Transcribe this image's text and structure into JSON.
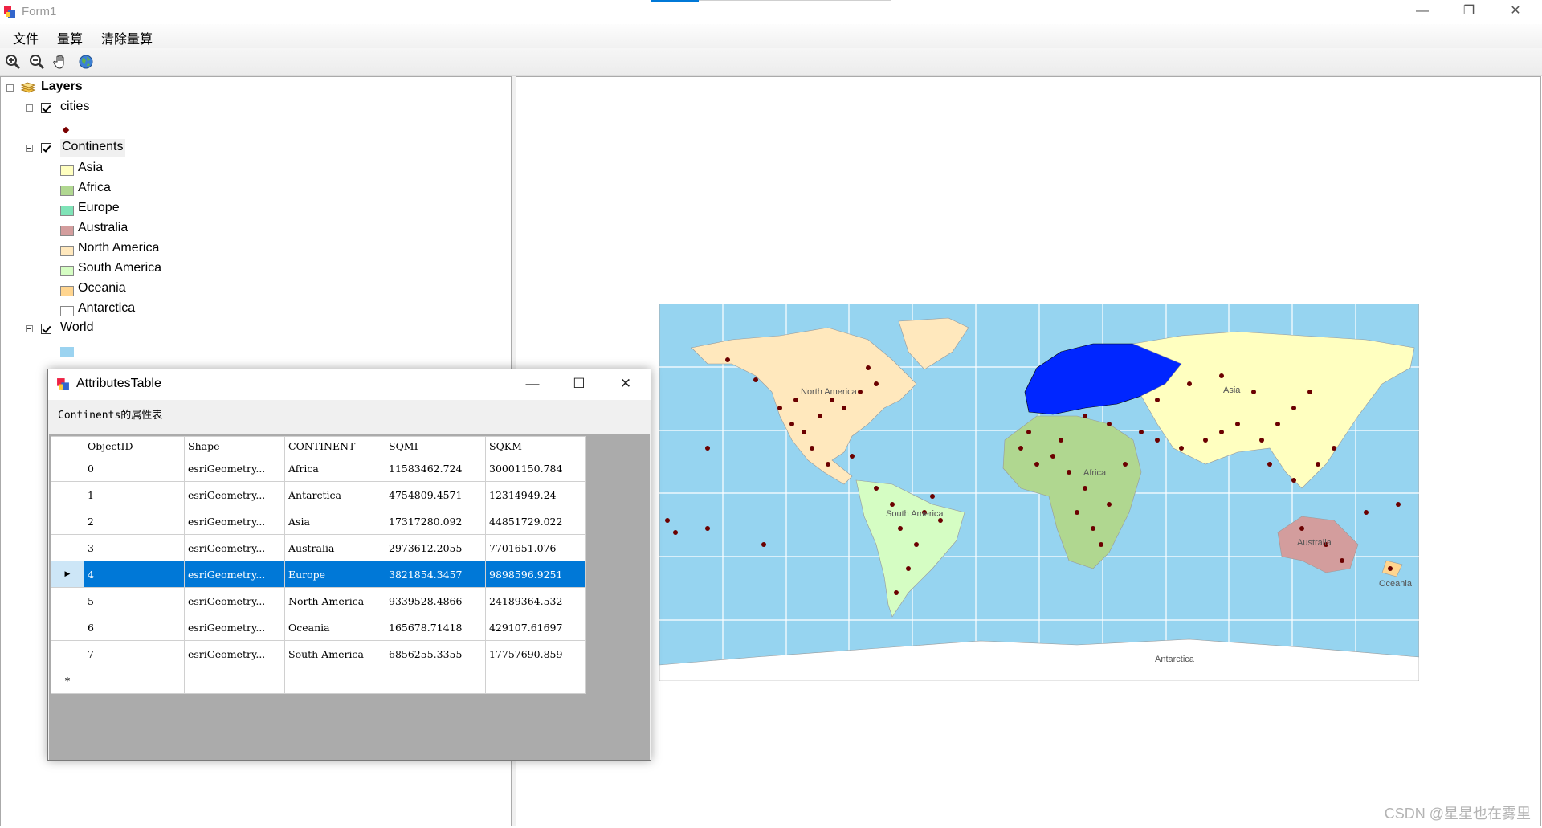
{
  "window": {
    "title": "Form1",
    "controls": {
      "minimize": "—",
      "restore": "❐",
      "close": "✕"
    }
  },
  "menu": {
    "items": [
      "文件",
      "量算",
      "清除量算"
    ]
  },
  "toolbar": {
    "tools": [
      "zoom-in-icon",
      "zoom-out-icon",
      "pan-hand-icon",
      "full-extent-globe-icon"
    ]
  },
  "toc": {
    "root": "Layers",
    "layers": [
      {
        "name": "cities",
        "checked": true
      },
      {
        "name": "Continents",
        "checked": true
      },
      {
        "name": "World",
        "checked": true
      }
    ],
    "continents_legend": [
      {
        "label": "Asia",
        "color": "#ffffc0"
      },
      {
        "label": "Africa",
        "color": "#b0d790"
      },
      {
        "label": "Europe",
        "color": "#7fe3b7"
      },
      {
        "label": "Australia",
        "color": "#d39d9d"
      },
      {
        "label": "North America",
        "color": "#ffe8bd"
      },
      {
        "label": "South America",
        "color": "#d5fdc3"
      },
      {
        "label": "Oceania",
        "color": "#ffd58f"
      },
      {
        "label": "Antarctica",
        "color": "#ffffff"
      }
    ],
    "world_color": "#9bd3f0",
    "cities_color": "#7a0000"
  },
  "map": {
    "ocean_color": "#96d4f0",
    "labels": [
      "North America",
      "Asia",
      "Africa",
      "South America",
      "Australia",
      "Oceania",
      "Antarctica"
    ]
  },
  "attributes": {
    "title": "AttributesTable",
    "caption": "Continents的属性表",
    "columns": [
      "ObjectID",
      "Shape",
      "CONTINENT",
      "SQMI",
      "SQKM"
    ],
    "rows": [
      [
        "0",
        "esriGeometry...",
        "Africa",
        "11583462.724",
        "30001150.784"
      ],
      [
        "1",
        "esriGeometry...",
        "Antarctica",
        "4754809.4571",
        "12314949.24"
      ],
      [
        "2",
        "esriGeometry...",
        "Asia",
        "17317280.092",
        "44851729.022"
      ],
      [
        "3",
        "esriGeometry...",
        "Australia",
        "2973612.2055",
        "7701651.076"
      ],
      [
        "4",
        "esriGeometry...",
        "Europe",
        "3821854.3457",
        "9898596.9251"
      ],
      [
        "5",
        "esriGeometry...",
        "North America",
        "9339528.4866",
        "24189364.532"
      ],
      [
        "6",
        "esriGeometry...",
        "Oceania",
        "165678.71418",
        "429107.61697"
      ],
      [
        "7",
        "esriGeometry...",
        "South America",
        "6856255.3355",
        "17757690.859"
      ]
    ],
    "selected_row": 4,
    "new_row_marker": "*",
    "current_row_marker": "▶",
    "selection_color": "#0078d7"
  },
  "watermark": "CSDN @星星也在雾里"
}
